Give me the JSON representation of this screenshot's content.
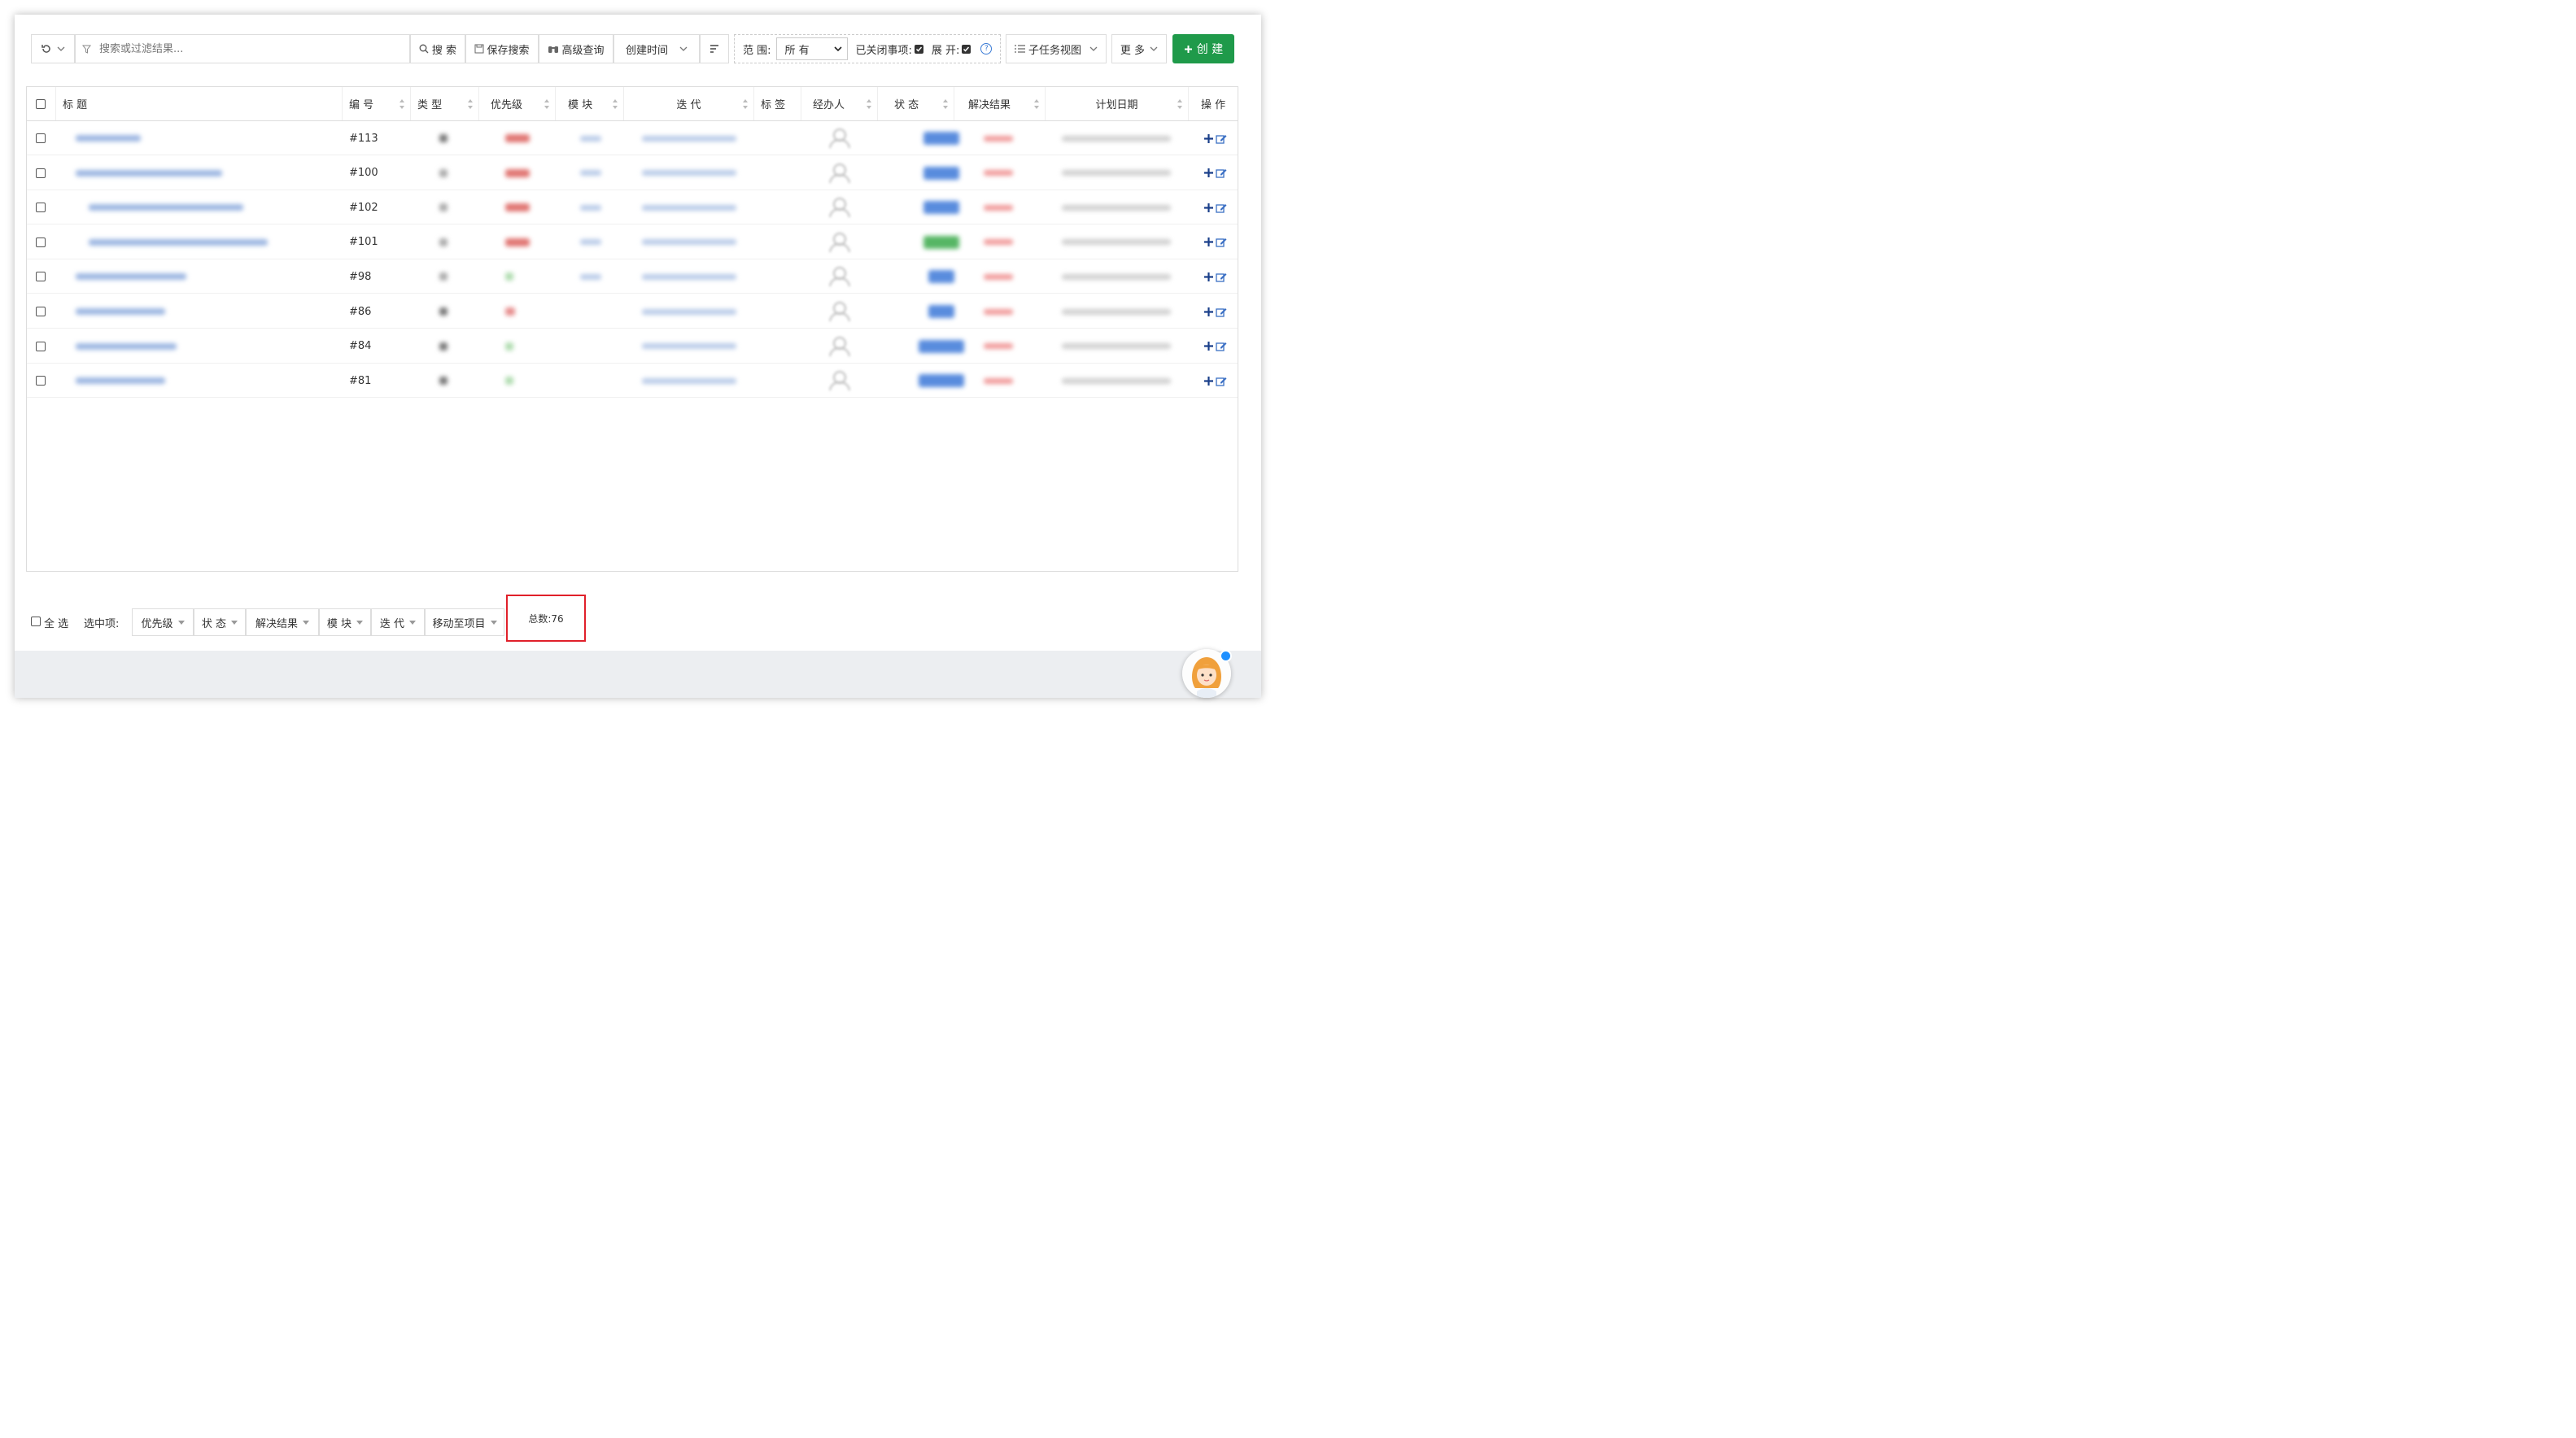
{
  "toolbar": {
    "search_placeholder": "搜索或过滤结果...",
    "search_label": "搜 索",
    "save_search_label": "保存搜索",
    "advanced_query_label": "高级查询",
    "sort_field_label": "创建时间",
    "scope_label": "范 围:",
    "scope_value": "所 有",
    "closed_items_label": "已关闭事项:",
    "closed_items_checked": true,
    "expand_label": "展 开:",
    "expand_checked": true,
    "subtask_view_label": "子任务视图",
    "more_label": "更 多",
    "create_label": "创 建"
  },
  "table": {
    "columns": [
      "标 题",
      "编 号",
      "类 型",
      "优先级",
      "模 块",
      "迭 代",
      "标 签",
      "经办人",
      "状 态",
      "解决结果",
      "计划日期",
      "操 作"
    ],
    "rows": [
      {
        "id": "#113",
        "title_indent": 0,
        "type_color": "#777",
        "priority_color": "#d9534f",
        "has_module": true,
        "status_color": "#3c78d8"
      },
      {
        "id": "#100",
        "title_indent": 0,
        "type_color": "#aaa",
        "priority_color": "#d9534f",
        "has_module": true,
        "status_color": "#3c78d8"
      },
      {
        "id": "#102",
        "title_indent": 1,
        "type_color": "#aaa",
        "priority_color": "#d9534f",
        "has_module": true,
        "status_color": "#3c78d8"
      },
      {
        "id": "#101",
        "title_indent": 1,
        "type_color": "#aaa",
        "priority_color": "#d9534f",
        "has_module": true,
        "status_color": "#3aaa4a"
      },
      {
        "id": "#98",
        "title_indent": 0,
        "type_color": "#aaa",
        "priority_color": "#9bd39b",
        "has_module": true,
        "status_color": "#3c78d8"
      },
      {
        "id": "#86",
        "title_indent": 0,
        "type_color": "#777",
        "priority_color": "#e07070",
        "has_module": false,
        "status_color": "#3c78d8"
      },
      {
        "id": "#84",
        "title_indent": 0,
        "type_color": "#777",
        "priority_color": "#9bd39b",
        "has_module": false,
        "status_color": "#3c78d8"
      },
      {
        "id": "#81",
        "title_indent": 0,
        "type_color": "#777",
        "priority_color": "#9bd39b",
        "has_module": false,
        "status_color": "#3c78d8"
      }
    ]
  },
  "bottom": {
    "select_all_label": "全 选",
    "selected_label": "选中项:",
    "actions": [
      "优先级",
      "状 态",
      "解决结果",
      "模 块",
      "迭 代",
      "移动至项目"
    ],
    "total_label": "总数:76"
  },
  "colors": {
    "create_button": "#1f9a4a",
    "highlight_border": "#e0202a",
    "link_blue": "#3a7bd5"
  }
}
